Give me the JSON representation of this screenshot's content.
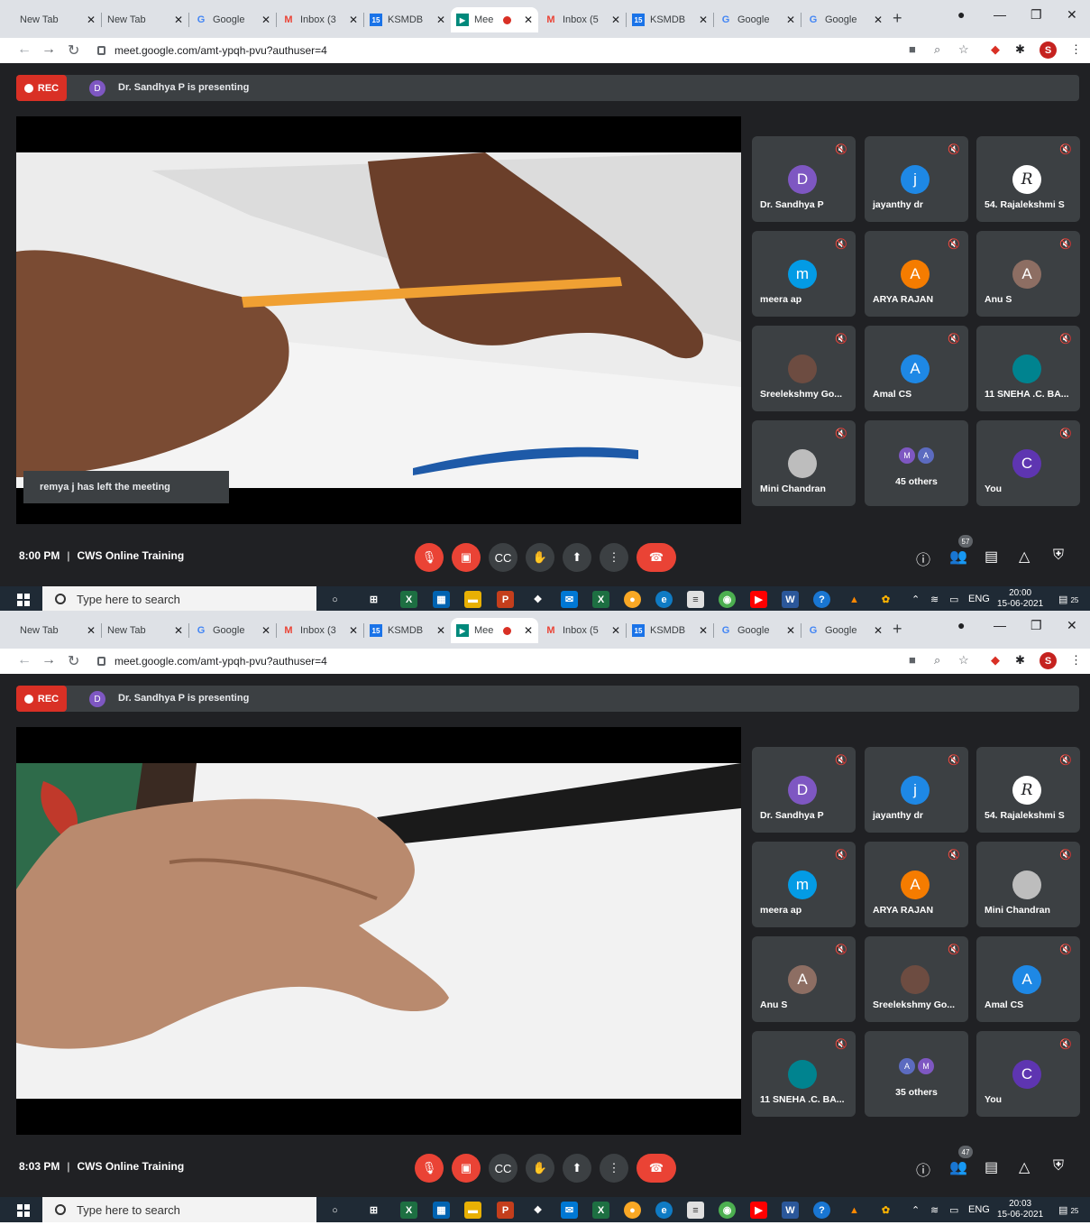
{
  "browser": {
    "tabs": [
      "New Tab",
      "New Tab",
      "Google",
      "Inbox (3",
      "KSMDB",
      "Mee",
      "Inbox (5",
      "KSMDB",
      "Google",
      "Google"
    ],
    "url": "meet.google.com/amt-ypqh-pvu?authuser=4",
    "profile_initial": "S"
  },
  "meet": {
    "rec_label": "REC",
    "presenter_initial": "D",
    "presenter_text": "Dr. Sandhya P is presenting",
    "meeting_name": "CWS Online Training"
  },
  "frames": [
    {
      "toast": "remya j has left the meeting",
      "time": "8:00 PM",
      "participants_badge": "57",
      "tiles": [
        {
          "name": "Dr. Sandhya P",
          "initial": "D",
          "color": "#7e57c2"
        },
        {
          "name": "jayanthy dr",
          "initial": "j",
          "color": "#1e88e5"
        },
        {
          "name": "54. Rajalekshmi S",
          "initial": "R",
          "color": "#ffffff"
        },
        {
          "name": "meera ap",
          "initial": "m",
          "color": "#039be5"
        },
        {
          "name": "ARYA RAJAN",
          "initial": "A",
          "color": "#f57c00"
        },
        {
          "name": "Anu S",
          "initial": "A",
          "color": "#8d6e63"
        },
        {
          "name": "Sreelekshmy Go...",
          "initial": "",
          "color": "#6d4c41"
        },
        {
          "name": "Amal CS",
          "initial": "A",
          "color": "#1e88e5"
        },
        {
          "name": "11 SNEHA .C. BA...",
          "initial": "",
          "color": "#00838f"
        },
        {
          "name": "Mini Chandran",
          "initial": "",
          "color": "#bdbdbd"
        },
        {
          "name": "45 others",
          "initial": "",
          "color": "",
          "others": [
            "M",
            "A"
          ]
        },
        {
          "name": "You",
          "initial": "C",
          "color": "#5e35b1"
        }
      ],
      "clock_time": "20:00",
      "clock_date": "15-06-2021"
    },
    {
      "toast": "",
      "time": "8:03 PM",
      "participants_badge": "47",
      "tiles": [
        {
          "name": "Dr. Sandhya P",
          "initial": "D",
          "color": "#7e57c2"
        },
        {
          "name": "jayanthy dr",
          "initial": "j",
          "color": "#1e88e5"
        },
        {
          "name": "54. Rajalekshmi S",
          "initial": "R",
          "color": "#ffffff"
        },
        {
          "name": "meera ap",
          "initial": "m",
          "color": "#039be5"
        },
        {
          "name": "ARYA RAJAN",
          "initial": "A",
          "color": "#f57c00"
        },
        {
          "name": "Mini Chandran",
          "initial": "",
          "color": "#bdbdbd"
        },
        {
          "name": "Anu S",
          "initial": "A",
          "color": "#8d6e63"
        },
        {
          "name": "Sreelekshmy Go...",
          "initial": "",
          "color": "#6d4c41"
        },
        {
          "name": "Amal CS",
          "initial": "A",
          "color": "#1e88e5"
        },
        {
          "name": "11 SNEHA .C. BA...",
          "initial": "",
          "color": "#00838f"
        },
        {
          "name": "35 others",
          "initial": "",
          "color": "",
          "others": [
            "A",
            "M"
          ]
        },
        {
          "name": "You",
          "initial": "C",
          "color": "#5e35b1"
        }
      ],
      "clock_time": "20:03",
      "clock_date": "15-06-2021"
    }
  ],
  "taskbar": {
    "search_placeholder": "Type here to search",
    "mail_badge": "47",
    "chrome_badge": "S",
    "lang": "ENG",
    "notif_count": "25"
  },
  "icons": {
    "mic_off": "mic-off-icon",
    "cam_off": "camera-off-icon",
    "captions": "captions-icon",
    "hand": "raise-hand-icon",
    "present": "present-icon",
    "more": "more-icon",
    "hangup": "hang-up-icon",
    "info": "info-icon",
    "people": "people-icon",
    "chat": "chat-icon",
    "activities": "activities-icon",
    "security": "security-icon"
  }
}
